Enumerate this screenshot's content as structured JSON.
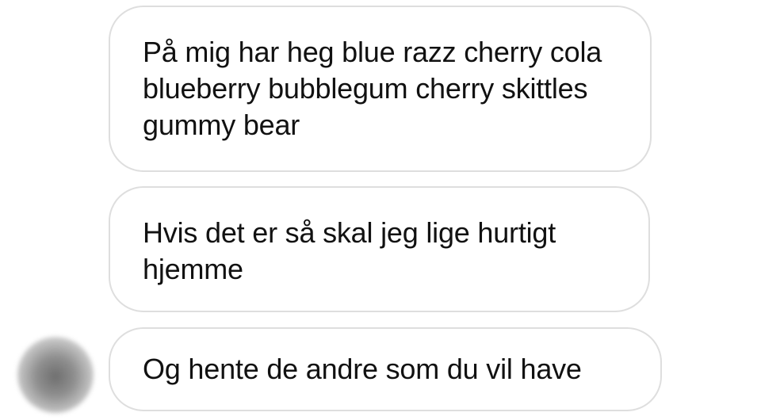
{
  "messages": [
    {
      "text": "På mig har heg blue razz cherry cola blueberry bubblegum cherry skittles gummy bear"
    },
    {
      "text": "Hvis det er så skal jeg lige hurtigt hjemme"
    },
    {
      "text": "Og hente de andre som du vil have"
    }
  ],
  "colors": {
    "background": "#ffffff",
    "bubble_border": "#dedede",
    "text": "#111111"
  },
  "icons": {
    "avatar": "blurred-avatar"
  }
}
